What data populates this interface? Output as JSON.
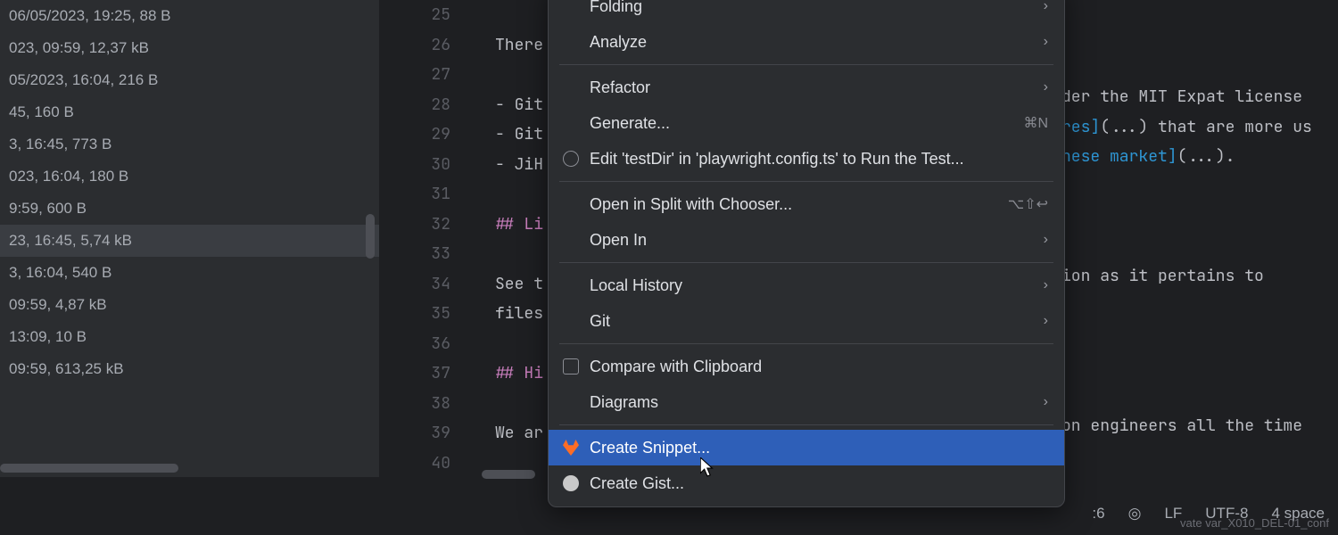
{
  "sidebar": {
    "items": [
      {
        "text": "06/05/2023, 19:25, 88 B"
      },
      {
        "text": "023, 09:59, 12,37 kB"
      },
      {
        "text": "05/2023, 16:04, 216 B"
      },
      {
        "text": "45, 160 B"
      },
      {
        "text": "3, 16:45, 773 B"
      },
      {
        "text": "023, 16:04, 180 B"
      },
      {
        "text": "9:59, 600 B"
      },
      {
        "text": "23, 16:45, 5,74 kB",
        "selected": true
      },
      {
        "text": "3, 16:04, 540 B"
      },
      {
        "text": "09:59, 4,87 kB"
      },
      {
        "text": "13:09, 10 B"
      },
      {
        "text": "09:59, 613,25 kB"
      }
    ]
  },
  "editor": {
    "line_start": 25,
    "lines": [
      {
        "n": 25,
        "t": ""
      },
      {
        "n": 26,
        "t": "There"
      },
      {
        "n": 27,
        "t": ""
      },
      {
        "n": 28,
        "t": "- Git"
      },
      {
        "n": 29,
        "t": "- Git"
      },
      {
        "n": 30,
        "t": "- JiH"
      },
      {
        "n": 31,
        "t": ""
      },
      {
        "n": 32,
        "t": "## Li",
        "heading": true
      },
      {
        "n": 33,
        "t": ""
      },
      {
        "n": 34,
        "t": "See t"
      },
      {
        "n": 35,
        "t": "files"
      },
      {
        "n": 36,
        "t": ""
      },
      {
        "n": 37,
        "t": "## Hi",
        "heading": true
      },
      {
        "n": 38,
        "t": ""
      },
      {
        "n": 39,
        "t": "We ar"
      },
      {
        "n": 40,
        "t": ""
      }
    ]
  },
  "right_editor": {
    "lines": [
      "der the MIT Expat license",
      "res](...) that are more us",
      "nese market](...).",
      "",
      "",
      "",
      "ion as it pertains to",
      "",
      "",
      "",
      "",
      "on engineers all the time"
    ]
  },
  "context_menu": {
    "items": [
      {
        "label": "Folding",
        "submenu": true
      },
      {
        "label": "Analyze",
        "submenu": true
      },
      {
        "sep": true
      },
      {
        "label": "Refactor",
        "submenu": true
      },
      {
        "label": "Generate...",
        "shortcut": "⌘N"
      },
      {
        "label": "Edit 'testDir' in 'playwright.config.ts' to Run the Test...",
        "icon": "gear"
      },
      {
        "sep": true
      },
      {
        "label": "Open in Split with Chooser...",
        "shortcut": "⌥⇧↩"
      },
      {
        "label": "Open In",
        "submenu": true
      },
      {
        "sep": true
      },
      {
        "label": "Local History",
        "submenu": true
      },
      {
        "label": "Git",
        "submenu": true
      },
      {
        "sep": true
      },
      {
        "label": "Compare with Clipboard",
        "icon": "compare"
      },
      {
        "label": "Diagrams",
        "submenu": true
      },
      {
        "sep": true
      },
      {
        "label": "Create Snippet...",
        "icon": "gitlab",
        "highlight": true
      },
      {
        "label": "Create Gist...",
        "icon": "github"
      }
    ]
  },
  "status_bar": {
    "position": ":6",
    "lf": "LF",
    "encoding": "UTF-8",
    "indent": "4 space",
    "fade": "vate var_X010_DEL-01_conf"
  }
}
